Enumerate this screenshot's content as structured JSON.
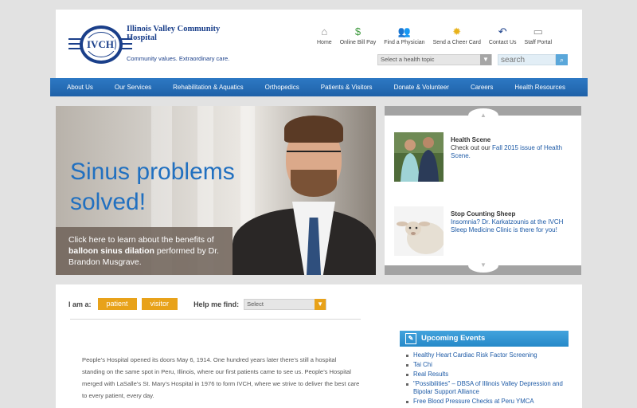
{
  "logo": {
    "initials": "IVCH",
    "name": "Illinois Valley Community Hospital",
    "tagline": "Community values. Extraordinary care."
  },
  "utility_nav": [
    {
      "label": "Home",
      "icon": "home-icon",
      "glyph": "⌂",
      "color": "#8a8a8a"
    },
    {
      "label": "Online Bill Pay",
      "icon": "dollar-icon",
      "glyph": "$",
      "color": "#3f9a3f"
    },
    {
      "label": "Find a Physician",
      "icon": "people-icon",
      "glyph": "👥",
      "color": "#2d79c4"
    },
    {
      "label": "Send a Cheer Card",
      "icon": "sun-icon",
      "glyph": "✹",
      "color": "#e8b21a"
    },
    {
      "label": "Contact Us",
      "icon": "reply-arrow-icon",
      "glyph": "↶",
      "color": "#1a3f8a"
    },
    {
      "label": "Staff Portal",
      "icon": "monitor-icon",
      "glyph": "▭",
      "color": "#8a8a8a"
    }
  ],
  "topic_select": {
    "value": "Select a health topic"
  },
  "search": {
    "placeholder": "search"
  },
  "main_nav": [
    "About Us",
    "Our Services",
    "Rehabilitation & Aquatics",
    "Orthopedics",
    "Patients & Visitors",
    "Donate & Volunteer",
    "Careers",
    "Health Resources"
  ],
  "hero": {
    "headline": "Sinus problems solved!",
    "caption_pre": "Click here to learn about the benefits of",
    "caption_bold": "balloon sinus dilation",
    "caption_post": "performed by Dr. Brandon Musgrave."
  },
  "stories": [
    {
      "title": "Health Scene",
      "body": "Check out our ",
      "link": "Fall 2015 issue of Health Scene."
    },
    {
      "title": "Stop Counting Sheep",
      "body": "",
      "link": "Insomnia? Dr. Karkatzounis at the IVCH Sleep Medicine Clinic is there for you!"
    }
  ],
  "audience": {
    "label": "I am a:",
    "options": [
      "patient",
      "visitor"
    ],
    "help_label": "Help me find:",
    "help_select": "Select"
  },
  "about_text": "People’s Hospital opened its doors May 6, 1914. One hundred years later there’s still a hospital standing on the same spot in Peru, Illinois, where our first patients came to see us. People’s Hospital merged with LaSalle’s St. Mary’s Hospital in 1976 to form IVCH, where we strive to deliver the best care to every patient, every day.",
  "events": {
    "title": "Upcoming Events",
    "items": [
      "Healthy Heart Cardiac Risk Factor Screening",
      "Tai Chi",
      "Real Results",
      "\"Possibilities\" – DBSA of Illinois Valley Depression and Bipolar Support Alliance",
      "Free Blood Pressure Checks at Peru YMCA"
    ]
  }
}
